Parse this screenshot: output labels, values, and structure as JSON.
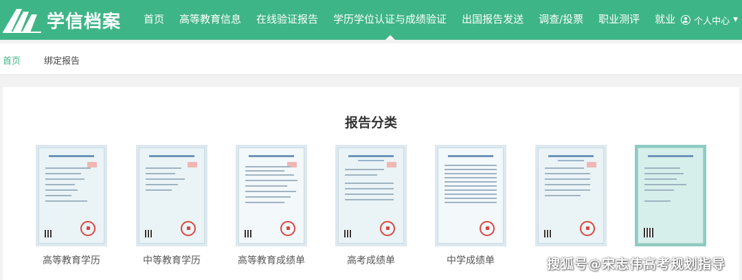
{
  "header": {
    "logo_text": "学信档案",
    "nav": [
      {
        "label": "首页"
      },
      {
        "label": "高等教育信息"
      },
      {
        "label": "在线验证报告"
      },
      {
        "label": "学历学位认证与成绩验证",
        "active": true
      },
      {
        "label": "出国报告发送"
      },
      {
        "label": "调查/投票"
      },
      {
        "label": "职业测评"
      },
      {
        "label": "就业"
      }
    ],
    "user_label": "个人中心",
    "brand_color": "#3eb587"
  },
  "breadcrumb": {
    "home": "首页",
    "current": "绑定报告"
  },
  "main": {
    "title": "报告分类",
    "reports": [
      {
        "label": "高等教育学历"
      },
      {
        "label": "中等教育学历"
      },
      {
        "label": "高等教育成绩单"
      },
      {
        "label": "高考成绩单"
      },
      {
        "label": "中学成绩单"
      },
      {
        "label": ""
      },
      {
        "label": ""
      }
    ]
  },
  "watermark": "搜狐号@宋志伟高考规划指导"
}
